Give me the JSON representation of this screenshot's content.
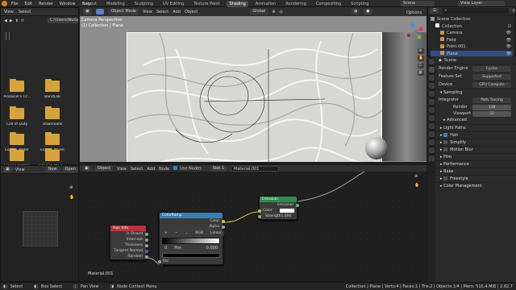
{
  "topbar": {
    "menus": [
      "File",
      "Edit",
      "Render",
      "Window",
      "Help"
    ],
    "workspace_tabs": [
      "Layout",
      "Modeling",
      "Sculpting",
      "UV Editing",
      "Texture Paint",
      "Shading",
      "Animation",
      "Rendering",
      "Compositing",
      "Scripting"
    ],
    "active_tab": "Shading",
    "scene_label": "Scene",
    "view_layer_label": "View Layer"
  },
  "filebrowser": {
    "menus": [
      "View",
      "Select"
    ],
    "path": "C:\\Users\\NuGe...",
    "items": [
      "Assassin's Cr...",
      "BandLab",
      "Call of Duty",
      "Downloads",
      "Eigene Bilder",
      "Eigene Musik",
      "Eigene Videos",
      "League of Le..."
    ]
  },
  "viewport": {
    "header_mode": "Object Mode",
    "menus": [
      "View",
      "Select",
      "Add",
      "Object"
    ],
    "orientation": "Global",
    "options_label": "Options",
    "overlay_line1": "Camera Perspective",
    "overlay_line2": "(1) Collection | Plane"
  },
  "image_editor": {
    "menus": [
      "View"
    ],
    "new_label": "New",
    "open_label": "Open"
  },
  "node_editor": {
    "editor_type": "Object",
    "menus": [
      "View",
      "Select",
      "Add",
      "Node"
    ],
    "use_nodes_label": "Use Nodes",
    "slot": "Slot 1",
    "material": "Material.001",
    "footer_material": "Material.001",
    "nodes": {
      "hair_info": {
        "title": "Hair Info",
        "color": "#b8343f",
        "outputs": [
          "Is Strand",
          "Intercept",
          "Thickness",
          "Tangent Normal",
          "Random"
        ]
      },
      "color_ramp": {
        "title": "ColorRamp",
        "color": "#3c7db0",
        "outputs": [
          "Color",
          "Alpha"
        ],
        "mode": "RGB",
        "interp": "Linear",
        "index": "0",
        "pos_label": "Pos",
        "pos_value": "0.000",
        "input": "Fac"
      },
      "emission": {
        "title": "Emission",
        "color": "#2f8a52",
        "output": "Emission",
        "color_label": "Color",
        "strength_label": "Strength",
        "strength_value": "1.000"
      }
    }
  },
  "outliner": {
    "header_label": "Scene Collection",
    "rows": [
      {
        "label": "Scene Collection",
        "icon_color": "#9a9a9a"
      },
      {
        "label": "Collection",
        "icon_color": "#ffffff"
      },
      {
        "label": "Camera",
        "icon_color": "#cf9548"
      },
      {
        "label": "Field",
        "icon_color": "#cf9548"
      },
      {
        "label": "Point.001",
        "icon_color": "#cf9548"
      },
      {
        "label": "Plane",
        "icon_color": "#cf9548"
      }
    ]
  },
  "properties": {
    "scene_label": "Scene",
    "render_engine_label": "Render Engine",
    "render_engine": "Cycles",
    "feature_set_label": "Feature Set",
    "feature_set": "Supported",
    "device_label": "Device",
    "device": "GPU Compute",
    "sampling_label": "Sampling",
    "integrator_label": "Integrator",
    "integrator": "Path Tracing",
    "render_label": "Render",
    "render_samples": "128",
    "viewport_label": "Viewport",
    "viewport_samples": "32",
    "advanced_label": "Advanced",
    "sections": [
      "Light Paths",
      "Hair",
      "Simplify",
      "Motion Blur",
      "Film",
      "Performance",
      "Bake",
      "Freestyle",
      "Color Management"
    ]
  },
  "statusbar": {
    "left": [
      "Select",
      "Box Select",
      "Pan View",
      "Node Context Menu"
    ],
    "right": "Collection | Plane | Verts:4 | Faces:1 | Tris:2 | Objects:1/4 | Mem: 516.4 MiB | 2.82.7"
  },
  "colors": {
    "accent": "#4a7fc0",
    "brand": "#e87d0d"
  }
}
